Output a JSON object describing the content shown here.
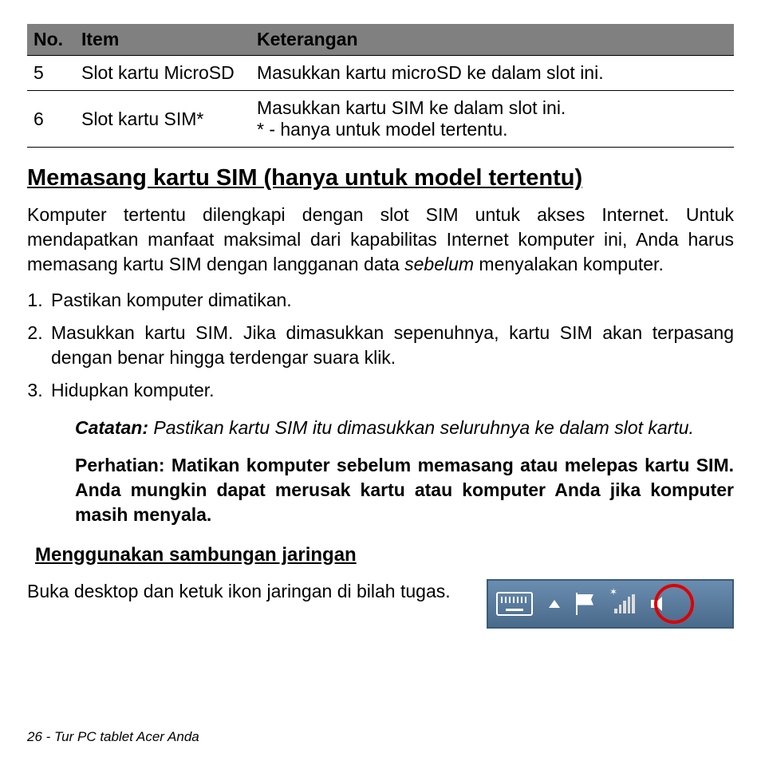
{
  "table": {
    "headers": {
      "no": "No.",
      "item": "Item",
      "desc": "Keterangan"
    },
    "rows": [
      {
        "no": "5",
        "item": "Slot kartu MicroSD",
        "desc": "Masukkan kartu microSD ke dalam slot ini."
      },
      {
        "no": "6",
        "item": "Slot kartu SIM*",
        "desc": "Masukkan kartu SIM ke dalam slot ini.\n* - hanya untuk model tertentu."
      }
    ]
  },
  "section_heading": "Memasang kartu SIM (hanya untuk model tertentu)",
  "intro_pre": "Komputer tertentu dilengkapi dengan slot SIM untuk akses Internet. Untuk mendapatkan manfaat maksimal dari kapabilitas Internet komputer ini, Anda harus memasang kartu SIM dengan langganan data ",
  "intro_em": "sebelum",
  "intro_post": " menyalakan komputer.",
  "steps": [
    "Pastikan komputer dimatikan.",
    "Masukkan kartu SIM. Jika dimasukkan sepenuhnya, kartu SIM akan terpasang dengan benar hingga terdengar suara klik.",
    "Hidupkan komputer."
  ],
  "note_label": "Catatan:",
  "note_text": " Pastikan kartu SIM itu dimasukkan seluruhnya ke dalam slot kartu.",
  "warning": "Perhatian: Matikan komputer sebelum memasang atau melepas kartu SIM. Anda mungkin dapat merusak kartu atau komputer Anda jika komputer masih menyala.",
  "subsection_heading": "Menggunakan sambungan jaringan",
  "subsection_body": "Buka desktop dan ketuk ikon jaringan di bilah tugas.",
  "footer": "26 - Tur PC tablet Acer Anda"
}
